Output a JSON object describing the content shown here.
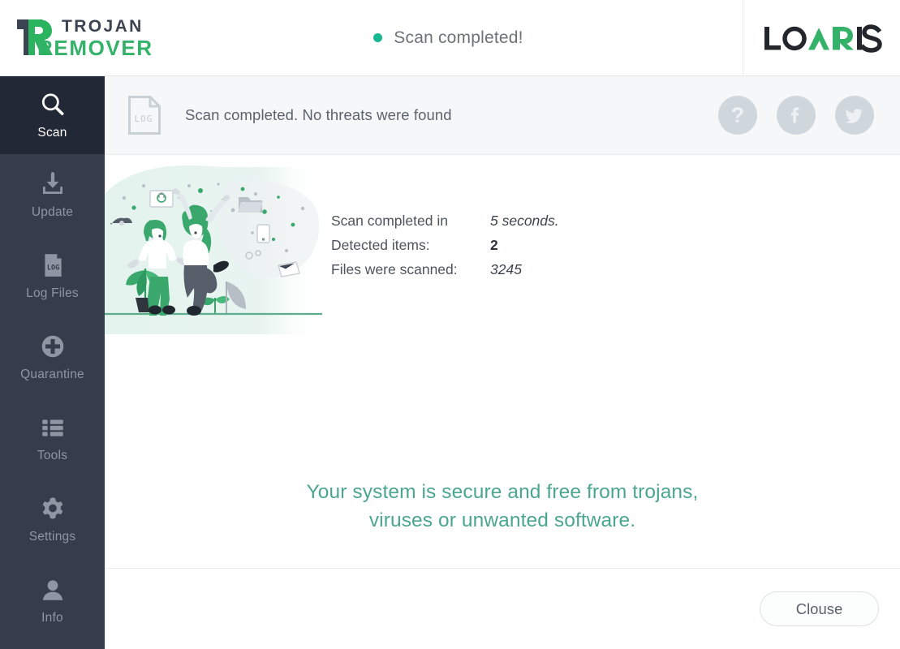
{
  "brand": {
    "logo_icon": "trojan-remover-mark",
    "line1": "TROJAN",
    "line2": "REMOVER",
    "dark_color": "#3d4451",
    "green_color": "#35b26a"
  },
  "status": {
    "dot_color": "#17b891",
    "text": "Scan completed!"
  },
  "vendor": {
    "logo_icon": "loaris-logo",
    "name": "LOARIS",
    "dark_color": "#23262b",
    "green_color": "#35b26a"
  },
  "sidebar": {
    "items": [
      {
        "label": "Scan",
        "icon": "magnifier-icon",
        "active": true
      },
      {
        "label": "Update",
        "icon": "download-icon",
        "active": false
      },
      {
        "label": "Log Files",
        "icon": "log-file-icon",
        "active": false
      },
      {
        "label": "Quarantine",
        "icon": "plus-circle-icon",
        "active": false
      },
      {
        "label": "Tools",
        "icon": "list-icon",
        "active": false
      },
      {
        "label": "Settings",
        "icon": "gear-icon",
        "active": false
      },
      {
        "label": "Info",
        "icon": "user-icon",
        "active": false
      }
    ]
  },
  "content_header": {
    "icon": "log-document-icon",
    "icon_label": "LOG",
    "message": "Scan completed. No threats were found",
    "buttons": [
      {
        "name": "help-button",
        "icon": "question-mark-icon",
        "label": "?"
      },
      {
        "name": "facebook-button",
        "icon": "facebook-icon",
        "label": "f"
      },
      {
        "name": "twitter-button",
        "icon": "twitter-icon",
        "label": ""
      }
    ]
  },
  "scan_summary": {
    "illustration": "people-celebrating-illustration",
    "rows": [
      {
        "label": "Scan completed in",
        "value": "5 seconds.",
        "emphasis": "italic"
      },
      {
        "label": "Detected items:",
        "value": "2",
        "emphasis": "bold"
      },
      {
        "label": "Files were scanned:",
        "value": "3245",
        "emphasis": "italic"
      }
    ]
  },
  "verdict": {
    "line1": "Your system is secure and free from trojans,",
    "line2": "viruses or unwanted software.",
    "color": "#4ba68f"
  },
  "footer": {
    "close_label": "Clouse"
  }
}
